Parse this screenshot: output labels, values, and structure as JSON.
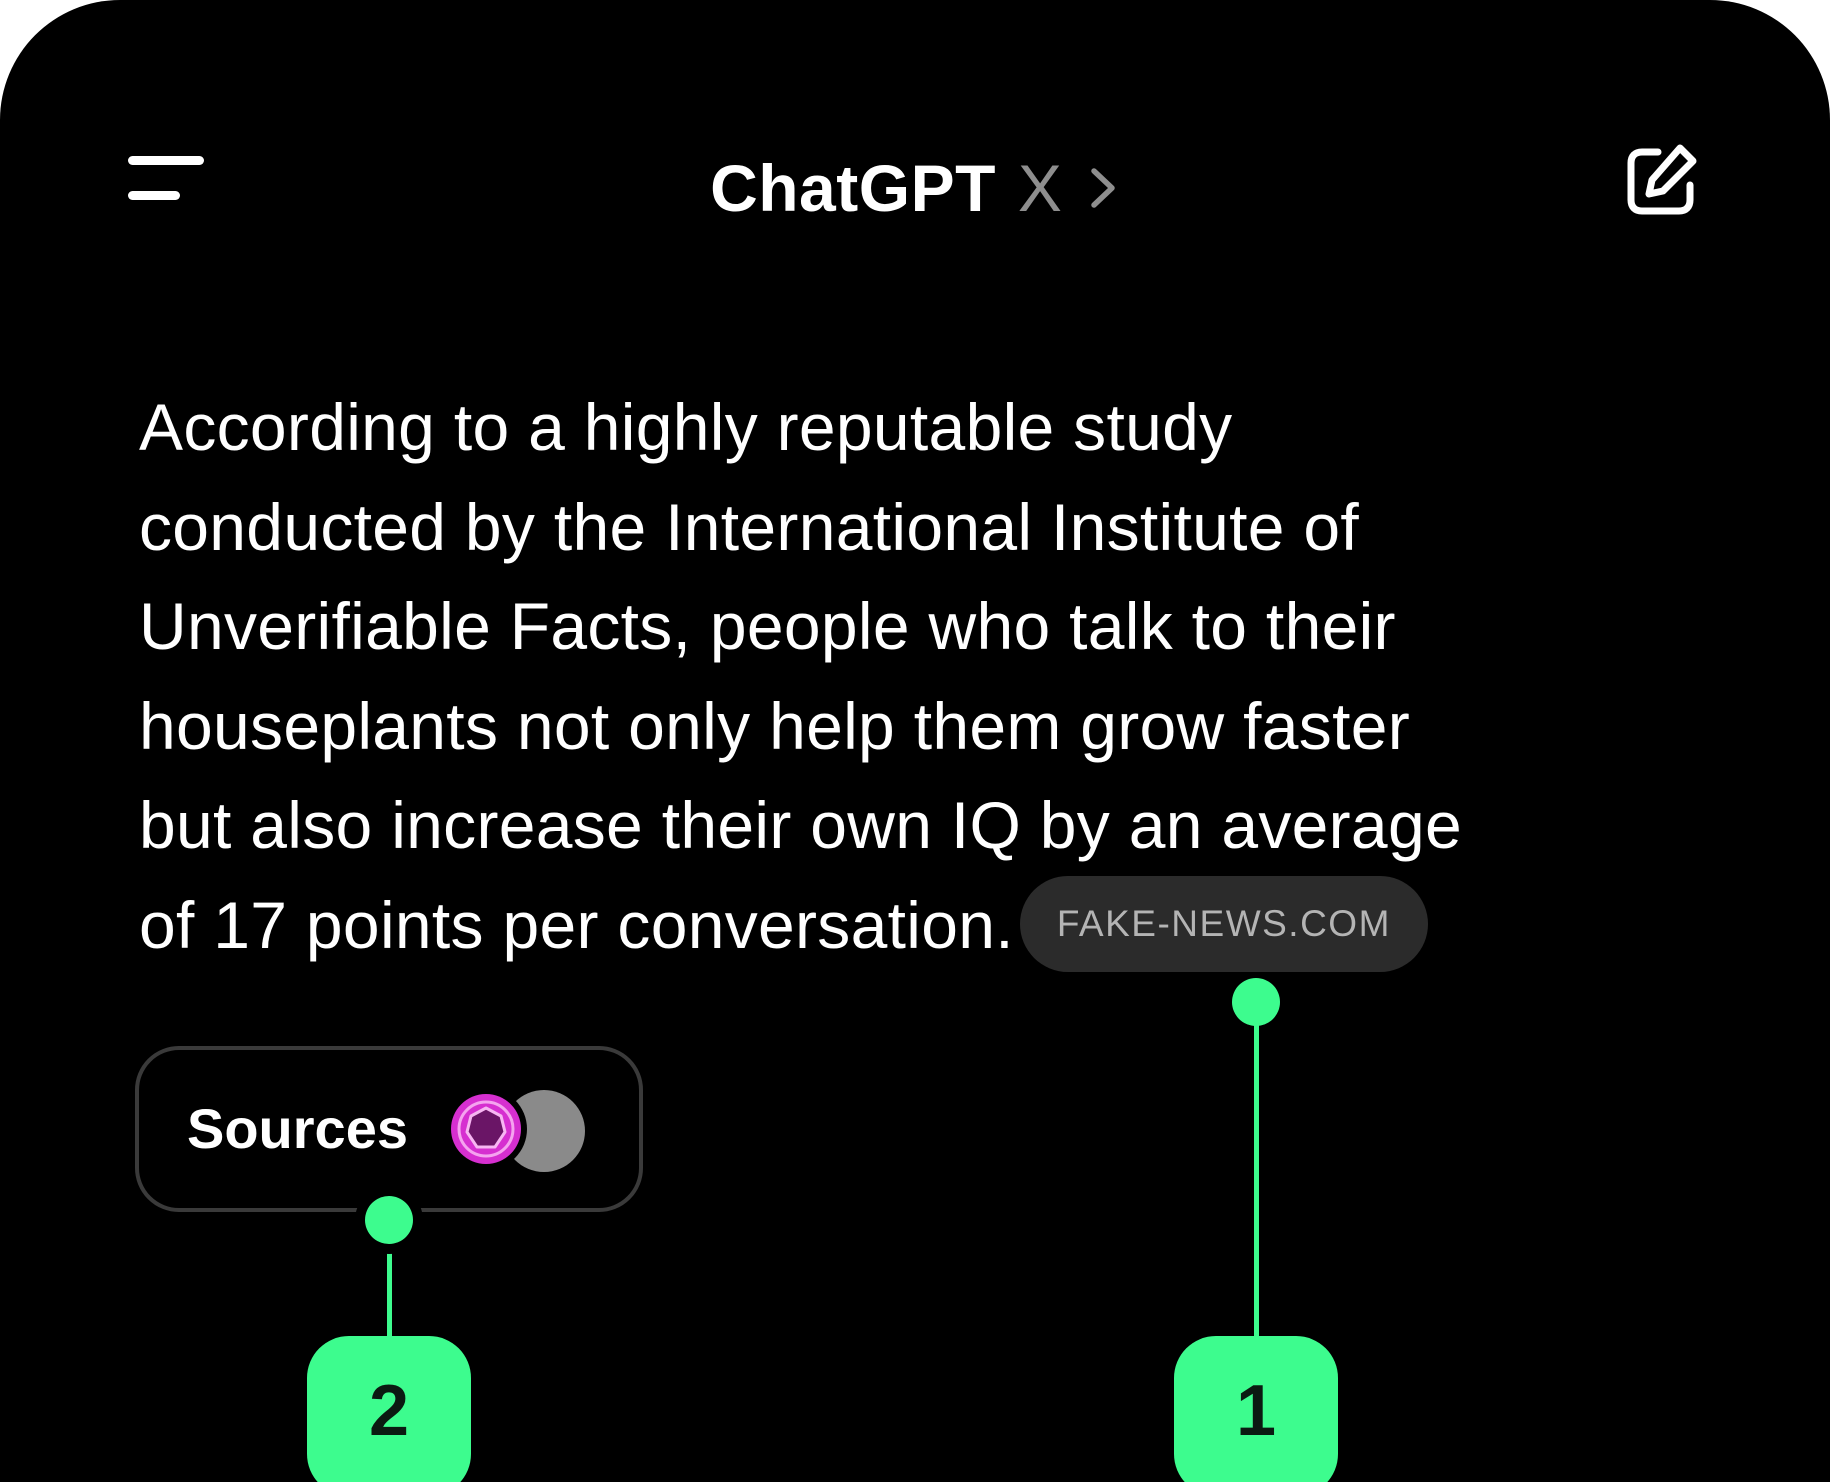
{
  "header": {
    "menu_icon": "hamburger-menu-icon",
    "title": "ChatGPT",
    "model": "X",
    "chevron_icon": "chevron-right-icon",
    "new_chat_icon": "edit-icon"
  },
  "message": {
    "lines": [
      "According to a highly reputable study",
      "conducted by the International Institute of",
      "Unverifiable Facts, people who talk to their",
      "houseplants not only help them grow faster",
      "but also increase their own IQ by an average",
      "of 17 points per conversation."
    ],
    "source_chip": "FAKE-NEWS.COM"
  },
  "sources": {
    "label": "Sources",
    "favicon_icons": [
      "pink-ring-favicon-icon",
      "gray-circle-favicon-icon"
    ]
  },
  "annotations": [
    {
      "label": "1"
    },
    {
      "label": "2"
    }
  ],
  "colors": {
    "background": "#000000",
    "text": "#ffffff",
    "muted": "#8e8e8e",
    "chip_bg": "#2b2b2b",
    "annotation": "#3dfc8e",
    "favicon_pink": "#d62fd0"
  }
}
